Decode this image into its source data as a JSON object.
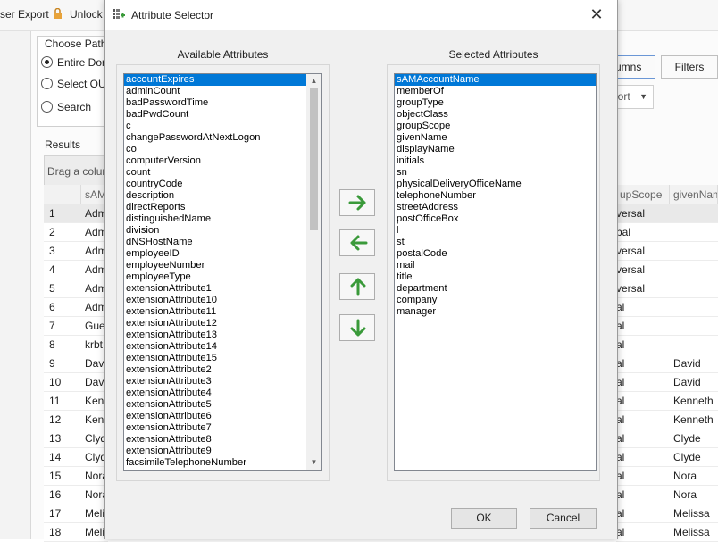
{
  "background": {
    "toolbar": {
      "export_label": "ser Export",
      "unlock_label": "Unlock"
    },
    "choose_paths": {
      "title": "Choose Paths",
      "options": [
        "Entire Dom",
        "Select OU c",
        "Search"
      ]
    },
    "results_label": "Results",
    "drag_hint": "Drag a colum",
    "buttons": {
      "columns": "umns",
      "filters": "Filters",
      "export_combo": "port"
    },
    "grid": {
      "left_header": "sAM",
      "right_headers": [
        "upScope",
        "givenNam"
      ],
      "rows": [
        {
          "num": "1",
          "sam": "Adm",
          "scope": "versal",
          "given": ""
        },
        {
          "num": "2",
          "sam": "Adm",
          "scope": "bal",
          "given": ""
        },
        {
          "num": "3",
          "sam": "Adm",
          "scope": "versal",
          "given": ""
        },
        {
          "num": "4",
          "sam": "Adm",
          "scope": "versal",
          "given": ""
        },
        {
          "num": "5",
          "sam": "Adm",
          "scope": "versal",
          "given": ""
        },
        {
          "num": "6",
          "sam": "Adm",
          "scope": "al",
          "given": ""
        },
        {
          "num": "7",
          "sam": "Gue",
          "scope": "al",
          "given": ""
        },
        {
          "num": "8",
          "sam": "krbt",
          "scope": "al",
          "given": ""
        },
        {
          "num": "9",
          "sam": "Dav",
          "scope": "al",
          "given": "David"
        },
        {
          "num": "10",
          "sam": "Dav",
          "scope": "al",
          "given": "David"
        },
        {
          "num": "11",
          "sam": "Kenn",
          "scope": "al",
          "given": "Kenneth"
        },
        {
          "num": "12",
          "sam": "Kenn",
          "scope": "al",
          "given": "Kenneth"
        },
        {
          "num": "13",
          "sam": "Clyd",
          "scope": "al",
          "given": "Clyde"
        },
        {
          "num": "14",
          "sam": "Clyd",
          "scope": "al",
          "given": "Clyde"
        },
        {
          "num": "15",
          "sam": "Nora",
          "scope": "al",
          "given": "Nora"
        },
        {
          "num": "16",
          "sam": "Nora",
          "scope": "al",
          "given": "Nora"
        },
        {
          "num": "17",
          "sam": "Melis",
          "scope": "al",
          "given": "Melissa"
        },
        {
          "num": "18",
          "sam": "Melis",
          "scope": "al",
          "given": "Melissa"
        }
      ]
    }
  },
  "dialog": {
    "title": "Attribute Selector",
    "available_label": "Available Attributes",
    "selected_label": "Selected Attributes",
    "available": [
      "accountExpires",
      "adminCount",
      "badPasswordTime",
      "badPwdCount",
      "c",
      "changePasswordAtNextLogon",
      "co",
      "computerVersion",
      "count",
      "countryCode",
      "description",
      "directReports",
      "distinguishedName",
      "division",
      "dNSHostName",
      "employeeID",
      "employeeNumber",
      "employeeType",
      "extensionAttribute1",
      "extensionAttribute10",
      "extensionAttribute11",
      "extensionAttribute12",
      "extensionAttribute13",
      "extensionAttribute14",
      "extensionAttribute15",
      "extensionAttribute2",
      "extensionAttribute3",
      "extensionAttribute4",
      "extensionAttribute5",
      "extensionAttribute6",
      "extensionAttribute7",
      "extensionAttribute8",
      "extensionAttribute9",
      "facsimileTelephoneNumber"
    ],
    "selected": [
      "sAMAccountName",
      "memberOf",
      "groupType",
      "objectClass",
      "groupScope",
      "givenName",
      "displayName",
      "initials",
      "sn",
      "physicalDeliveryOfficeName",
      "telephoneNumber",
      "streetAddress",
      "postOfficeBox",
      "l",
      "st",
      "postalCode",
      "mail",
      "title",
      "department",
      "company",
      "manager"
    ],
    "available_selected_index": 0,
    "selected_selected_index": 0,
    "ok_label": "OK",
    "cancel_label": "Cancel",
    "arrow_color": "#3a9a3a"
  }
}
